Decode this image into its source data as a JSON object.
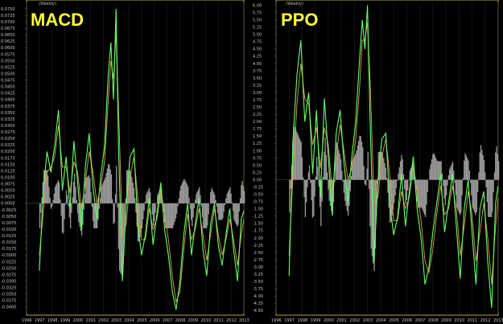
{
  "chart_data": [
    {
      "type": "line",
      "title": "MACD",
      "period_label": "(Weekly)",
      "ylim": [
        -0.0425,
        0.0775
      ],
      "yticks": [
        "0.0750",
        "0.0725",
        "0.0700",
        "0.0675",
        "0.0650",
        "0.0625",
        "0.0600",
        "0.0575",
        "0.0550",
        "0.0525",
        "0.0500",
        "0.0475",
        "0.0450",
        "0.0425",
        "0.0400",
        "0.0375",
        "0.0350",
        "0.0325",
        "0.0300",
        "0.0275",
        "0.0250",
        "0.0225",
        "0.0200",
        "0.0175",
        "0.0150",
        "0.0125",
        "0.0100",
        "0.0075",
        "0.0050",
        "0.0025",
        "0.0000",
        "-0.0025",
        "-0.0050",
        "-0.0075",
        "-0.0100",
        "-0.0125",
        "-0.0150",
        "-0.0175",
        "-0.0200",
        "-0.0225",
        "-0.0250",
        "-0.0275",
        "-0.0300",
        "-0.0325",
        "-0.0350",
        "-0.0375",
        "-0.0400"
      ],
      "xticks": [
        "1996",
        "1997",
        "1998",
        "1999",
        "2000",
        "2001",
        "2002",
        "2003",
        "2004",
        "2005",
        "2006",
        "2007",
        "2008",
        "2009",
        "2010",
        "2011",
        "2012",
        "2013"
      ],
      "series": [
        {
          "role": "indicator",
          "color": "#66ff66",
          "x": [
            1997.0,
            1997.3,
            1997.6,
            1997.9,
            1998.2,
            1998.5,
            1998.8,
            1999.1,
            1999.4,
            1999.7,
            2000.0,
            2000.3,
            2000.6,
            2000.9,
            2001.2,
            2001.5,
            2001.8,
            2002.1,
            2002.4,
            2002.6,
            2002.8,
            2003.0,
            2003.2,
            2003.5,
            2003.8,
            2004.1,
            2004.4,
            2004.7,
            2005.0,
            2005.3,
            2005.6,
            2005.9,
            2006.2,
            2006.5,
            2006.8,
            2007.1,
            2007.4,
            2007.7,
            2008.0,
            2008.3,
            2008.6,
            2008.9,
            2009.2,
            2009.5,
            2009.8,
            2010.1,
            2010.4,
            2010.7,
            2011.0,
            2011.3,
            2011.6,
            2011.9,
            2012.2,
            2012.5,
            2012.8,
            2013.0
          ],
          "y": [
            -0.026,
            0.004,
            0.02,
            0.012,
            0.022,
            0.036,
            0.005,
            0.018,
            -0.002,
            0.024,
            0.008,
            -0.01,
            0.014,
            0.027,
            0.006,
            -0.006,
            0.01,
            0.022,
            0.05,
            0.062,
            0.04,
            0.075,
            0.02,
            -0.03,
            0.0,
            0.018,
            0.021,
            -0.008,
            -0.02,
            -0.012,
            0.002,
            -0.016,
            -0.004,
            0.008,
            -0.01,
            -0.02,
            -0.034,
            -0.041,
            -0.03,
            -0.012,
            0.0,
            -0.02,
            -0.008,
            0.002,
            -0.018,
            -0.028,
            -0.008,
            0.0,
            -0.016,
            -0.024,
            -0.012,
            -0.002,
            -0.018,
            -0.03,
            -0.006,
            -0.003
          ]
        },
        {
          "role": "signal",
          "color": "#d4a24c",
          "x": [
            1997.0,
            1997.3,
            1997.6,
            1997.9,
            1998.2,
            1998.5,
            1998.8,
            1999.1,
            1999.4,
            1999.7,
            2000.0,
            2000.3,
            2000.6,
            2000.9,
            2001.2,
            2001.5,
            2001.8,
            2002.1,
            2002.4,
            2002.6,
            2002.8,
            2003.0,
            2003.2,
            2003.5,
            2003.8,
            2004.1,
            2004.4,
            2004.7,
            2005.0,
            2005.3,
            2005.6,
            2005.9,
            2006.2,
            2006.5,
            2006.8,
            2007.1,
            2007.4,
            2007.7,
            2008.0,
            2008.3,
            2008.6,
            2008.9,
            2009.2,
            2009.5,
            2009.8,
            2010.1,
            2010.4,
            2010.7,
            2011.0,
            2011.3,
            2011.6,
            2011.9,
            2012.2,
            2012.5,
            2012.8,
            2013.0
          ],
          "y": [
            -0.02,
            -0.004,
            0.012,
            0.014,
            0.018,
            0.03,
            0.014,
            0.014,
            0.004,
            0.016,
            0.012,
            -0.002,
            0.008,
            0.02,
            0.012,
            0.0,
            0.006,
            0.016,
            0.04,
            0.055,
            0.048,
            0.066,
            0.036,
            -0.012,
            -0.008,
            0.01,
            0.018,
            0.002,
            -0.014,
            -0.014,
            -0.002,
            -0.01,
            -0.006,
            0.004,
            -0.004,
            -0.014,
            -0.028,
            -0.038,
            -0.034,
            -0.018,
            -0.004,
            -0.014,
            -0.01,
            -0.002,
            -0.012,
            -0.022,
            -0.012,
            -0.002,
            -0.012,
            -0.02,
            -0.014,
            -0.006,
            -0.014,
            -0.024,
            -0.012,
            -0.006
          ]
        }
      ]
    },
    {
      "type": "line",
      "title": "PPO",
      "period_label": "(Weekly)",
      "ylim": [
        -4.6,
        6.1
      ],
      "yticks": [
        "6.00",
        "5.75",
        "5.50",
        "5.25",
        "5.00",
        "4.75",
        "4.50",
        "4.25",
        "4.00",
        "3.75",
        "3.50",
        "3.25",
        "3.00",
        "2.75",
        "2.50",
        "2.25",
        "2.00",
        "1.75",
        "1.50",
        "1.25",
        "1.00",
        "0.75",
        "0.50",
        "0.25",
        "0.00",
        "-0.25",
        "-0.50",
        "-0.75",
        "-1.00",
        "-1.25",
        "-1.50",
        "-1.75",
        "-2.00",
        "-2.25",
        "-2.50",
        "-2.75",
        "-3.00",
        "-3.25",
        "-3.50",
        "-3.75",
        "-4.00",
        "-4.25",
        "-4.50"
      ],
      "xticks": [
        "1996",
        "1997",
        "1998",
        "1999",
        "2000",
        "2001",
        "2002",
        "2003",
        "2004",
        "2005",
        "2006",
        "2007",
        "2008",
        "2009",
        "2010",
        "2011",
        "2012",
        "2013"
      ],
      "series": [
        {
          "role": "indicator",
          "color": "#66ff66",
          "x": [
            1997.0,
            1997.3,
            1997.6,
            1997.9,
            1998.2,
            1998.5,
            1998.8,
            1999.1,
            1999.4,
            1999.7,
            2000.0,
            2000.3,
            2000.6,
            2000.9,
            2001.2,
            2001.5,
            2001.8,
            2002.1,
            2002.4,
            2002.6,
            2002.8,
            2003.0,
            2003.2,
            2003.5,
            2003.8,
            2004.1,
            2004.4,
            2004.7,
            2005.0,
            2005.3,
            2005.6,
            2005.9,
            2006.2,
            2006.5,
            2006.8,
            2007.1,
            2007.4,
            2007.7,
            2008.0,
            2008.3,
            2008.6,
            2008.9,
            2009.2,
            2009.5,
            2009.8,
            2010.1,
            2010.4,
            2010.7,
            2011.0,
            2011.3,
            2011.6,
            2011.9,
            2012.2,
            2012.5,
            2012.8,
            2013.0
          ],
          "y": [
            -3.3,
            1.4,
            3.6,
            4.8,
            2.0,
            3.0,
            0.2,
            2.4,
            -0.6,
            2.8,
            0.8,
            -1.2,
            1.6,
            2.4,
            0.6,
            -0.8,
            0.8,
            2.0,
            4.2,
            5.5,
            4.5,
            6.0,
            2.0,
            -2.8,
            0.0,
            1.4,
            1.6,
            -0.8,
            -1.9,
            -1.3,
            0.2,
            -1.6,
            -0.4,
            0.8,
            -1.0,
            -2.0,
            -3.6,
            -3.0,
            -1.8,
            -0.8,
            0.2,
            -1.8,
            -0.8,
            0.2,
            -1.6,
            -3.4,
            -1.0,
            0.0,
            -1.8,
            -3.6,
            -1.0,
            -0.4,
            -2.8,
            -4.4,
            -0.8,
            -0.2
          ]
        },
        {
          "role": "signal",
          "color": "#d4a24c",
          "x": [
            1997.0,
            1997.3,
            1997.6,
            1997.9,
            1998.2,
            1998.5,
            1998.8,
            1999.1,
            1999.4,
            1999.7,
            2000.0,
            2000.3,
            2000.6,
            2000.9,
            2001.2,
            2001.5,
            2001.8,
            2002.1,
            2002.4,
            2002.6,
            2002.8,
            2003.0,
            2003.2,
            2003.5,
            2003.8,
            2004.1,
            2004.4,
            2004.7,
            2005.0,
            2005.3,
            2005.6,
            2005.9,
            2006.2,
            2006.5,
            2006.8,
            2007.1,
            2007.4,
            2007.7,
            2008.0,
            2008.3,
            2008.6,
            2008.9,
            2009.2,
            2009.5,
            2009.8,
            2010.1,
            2010.4,
            2010.7,
            2011.0,
            2011.3,
            2011.6,
            2011.9,
            2012.2,
            2012.5,
            2012.8,
            2013.0
          ],
          "y": [
            -2.6,
            0.2,
            2.6,
            4.0,
            2.8,
            2.6,
            1.2,
            1.8,
            0.4,
            1.8,
            1.2,
            -0.4,
            0.8,
            1.9,
            1.0,
            0.0,
            0.4,
            1.4,
            3.2,
            4.8,
            4.8,
            5.4,
            3.4,
            -0.8,
            -0.6,
            0.8,
            1.4,
            0.2,
            -1.4,
            -1.4,
            -0.4,
            -1.0,
            -0.6,
            0.4,
            -0.4,
            -1.4,
            -2.8,
            -3.2,
            -2.4,
            -1.2,
            -0.2,
            -1.2,
            -1.0,
            -0.2,
            -1.0,
            -2.6,
            -1.6,
            -0.4,
            -1.2,
            -2.8,
            -1.8,
            -0.8,
            -2.0,
            -3.6,
            -1.6,
            -0.6
          ]
        }
      ]
    }
  ]
}
